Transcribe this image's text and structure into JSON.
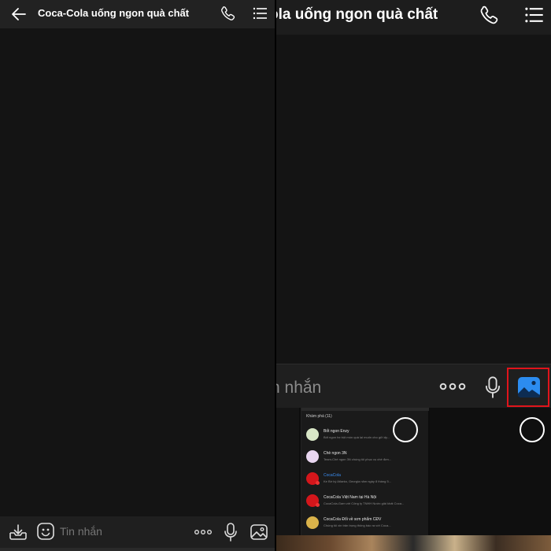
{
  "left": {
    "chat_title": "Coca-Cola uống ngon quà chất",
    "input_placeholder": "Tin nhắn"
  },
  "right": {
    "chat_title_partial": "ola uống ngon quà chất",
    "input_placeholder_partial": "n nhắn"
  },
  "gallery": {
    "mini_header": "Khám phá (11)",
    "mini_rows": [
      {
        "name": "Bốt ngon Enzy",
        "highlight": "ngon",
        "msg": "Bốt ngon hẹ bột món quà lại muốn cho gửi ấy...",
        "avatar_color": "#d8e6c6"
      },
      {
        "name": "Chè ngon 3N",
        "highlight": "ngon",
        "msg": "Team-Chè ngon 3N chúng tôi phục vụ chè đơn...",
        "avatar_color": "#e9d6f0"
      },
      {
        "name": "CocaCola",
        "highlight": "CocaCola",
        "msg": "Ke Bờ ký Atlanta, Georgia năm ngày 8 tháng 5...",
        "avatar_color": "#d4161b"
      },
      {
        "name": "CocaCola Việt Nam tại Hà Nội",
        "highlight": "CocaCola",
        "msg": "CocaCola-Gam với Công ty TNHH Nước giải khát Coca...",
        "avatar_color": "#d4161b"
      },
      {
        "name": "CocaCola Đổi về sơn phẩm CĐV",
        "highlight": "CocaCola",
        "msg": "Chúng tôi xin trân trọng thông báo ra với Coca...",
        "avatar_color": "#d9b24a"
      }
    ]
  },
  "colors": {
    "accent_blue": "#2c8cf0",
    "highlight_red": "#e0141b",
    "header_bg": "#222222",
    "body_bg": "#141414"
  },
  "icons": [
    "back-arrow-icon",
    "phone-icon",
    "list-menu-icon",
    "sticker-icon",
    "emoji-icon",
    "more-dots-icon",
    "microphone-icon",
    "image-icon"
  ]
}
